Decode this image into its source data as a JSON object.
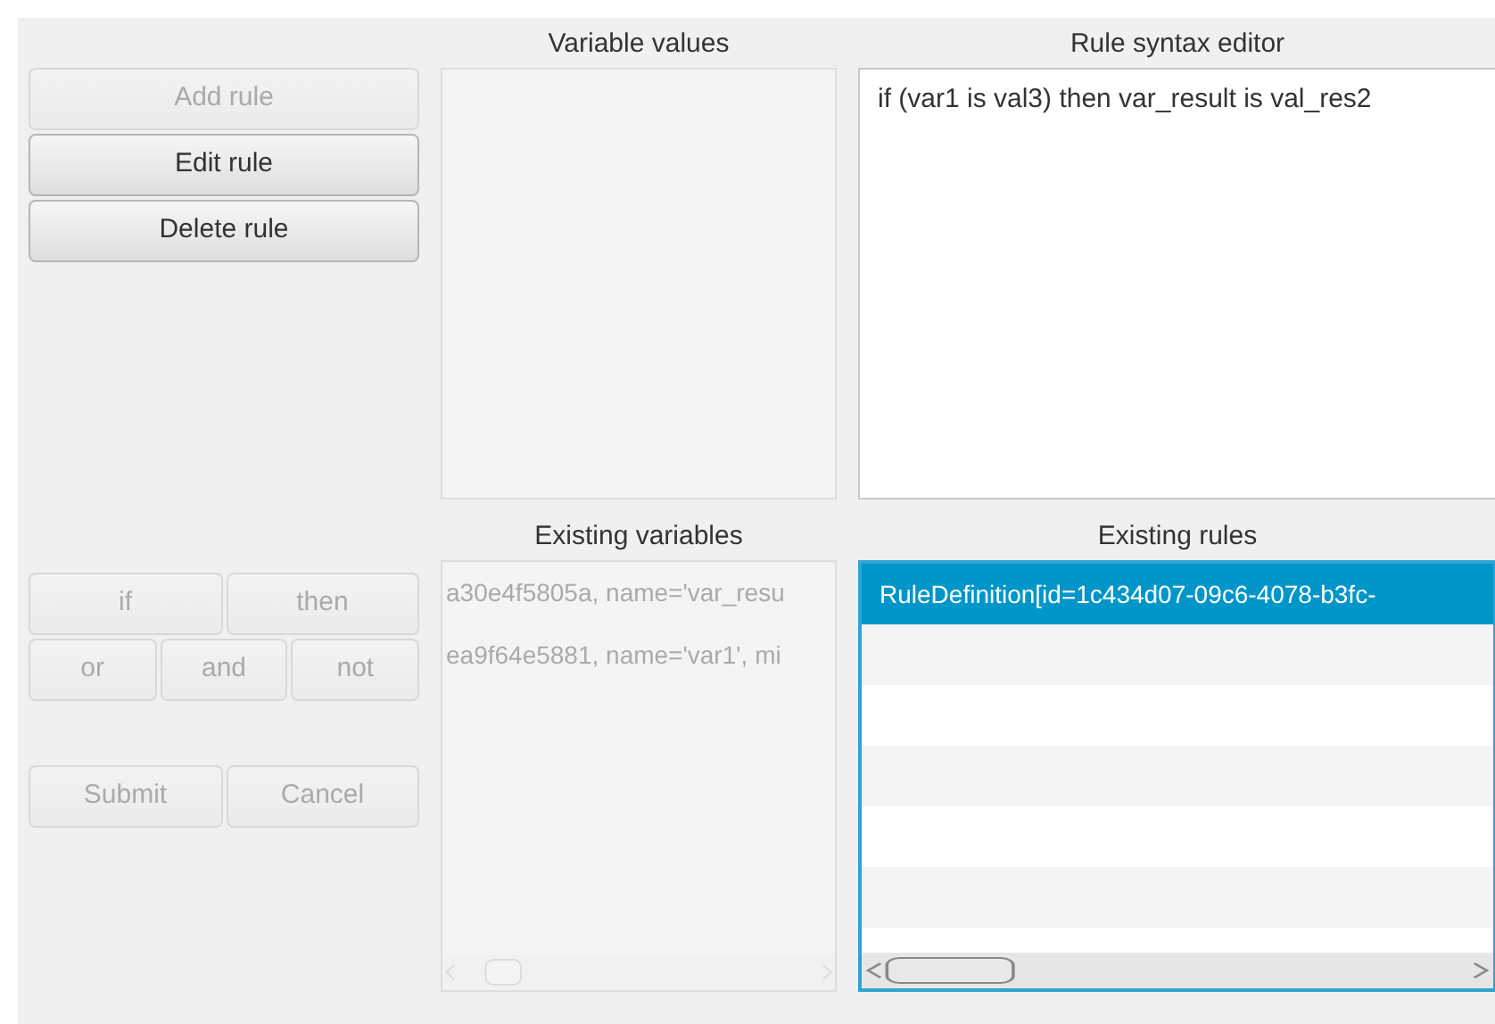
{
  "actions": [
    {
      "label": "Add rule",
      "disabled": true
    },
    {
      "label": "Edit rule",
      "disabled": false
    },
    {
      "label": "Delete rule",
      "disabled": false
    }
  ],
  "variable_values": {
    "title": "Variable values"
  },
  "editor": {
    "title": "Rule syntax editor",
    "value": "if (var1 is val3) then var_result is val_res2"
  },
  "keyword_rows": [
    [
      {
        "label": "if",
        "disabled": true
      },
      {
        "label": "then",
        "disabled": true
      }
    ],
    [
      {
        "label": "or",
        "disabled": true
      },
      {
        "label": "and",
        "disabled": true
      },
      {
        "label": "not",
        "disabled": true
      }
    ]
  ],
  "form_buttons": [
    {
      "label": "Submit",
      "disabled": true
    },
    {
      "label": "Cancel",
      "disabled": true
    }
  ],
  "variables": {
    "title": "Existing variables",
    "disabled": true,
    "items": [
      "a30e4f5805a, name='var_resu",
      "ea9f64e5881, name='var1', mi"
    ]
  },
  "rules": {
    "title": "Existing rules",
    "focused": true,
    "items": [
      {
        "text": "RuleDefinition[id=1c434d07-09c6-4078-b3fc-",
        "selected": true
      }
    ]
  }
}
